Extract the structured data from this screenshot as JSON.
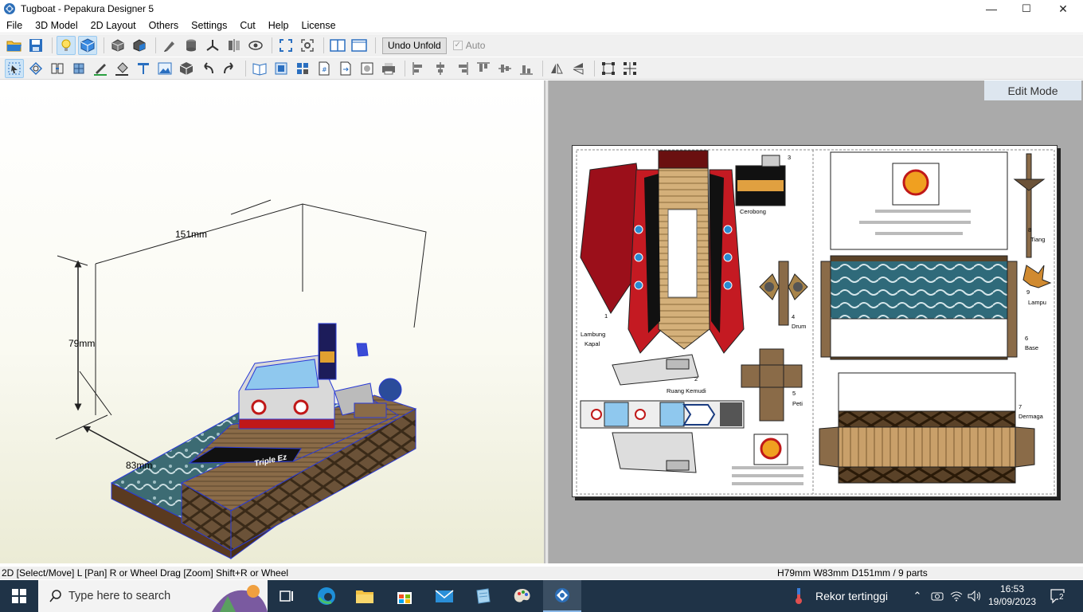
{
  "window": {
    "title": "Tugboat - Pepakura Designer 5",
    "controls": {
      "minimize": "—",
      "maximize": "☐",
      "close": "✕"
    }
  },
  "menu": [
    "File",
    "3D Model",
    "2D Layout",
    "Others",
    "Settings",
    "Cut",
    "Help",
    "License"
  ],
  "toolbar1": {
    "undo_unfold_label": "Undo Unfold",
    "auto_label": "Auto",
    "auto_checked": true
  },
  "view3d": {
    "dimension_width": "151mm",
    "dimension_height": "79mm",
    "dimension_depth": "83mm",
    "hull_text": "Triple Ez",
    "background_top": "#ffffff",
    "background_bottom": "#ebebd5",
    "edge_color": "#2a3bd6"
  },
  "view2d": {
    "mode_label": "Edit Mode",
    "background": "#aaaaaa",
    "part_labels": {
      "p1": "1",
      "p1_name_a": "Lambung",
      "p1_name_b": "Kapal",
      "p2": "2",
      "p2_name": "Ruang Kemudi",
      "p3": "3",
      "p3_name": "Cerobong",
      "p4": "4",
      "p4_name": "Drum",
      "p5": "5",
      "p5_name": "Peti",
      "p6": "6",
      "p6_name": "Base",
      "p7": "7",
      "p7_name": "Dermaga",
      "p8": "8",
      "p8_name": "Tiang",
      "p9": "9",
      "p9_name": "Lampu"
    }
  },
  "status": {
    "hint": "2D [Select/Move] L [Pan] R or Wheel Drag [Zoom] Shift+R or Wheel",
    "dims": "H79mm W83mm D151mm / 9 parts"
  },
  "taskbar": {
    "search_placeholder": "Type here to search",
    "weather_text": "Rekor tertinggi",
    "time": "16:53",
    "date": "19/09/2023",
    "notification_count": "2"
  }
}
